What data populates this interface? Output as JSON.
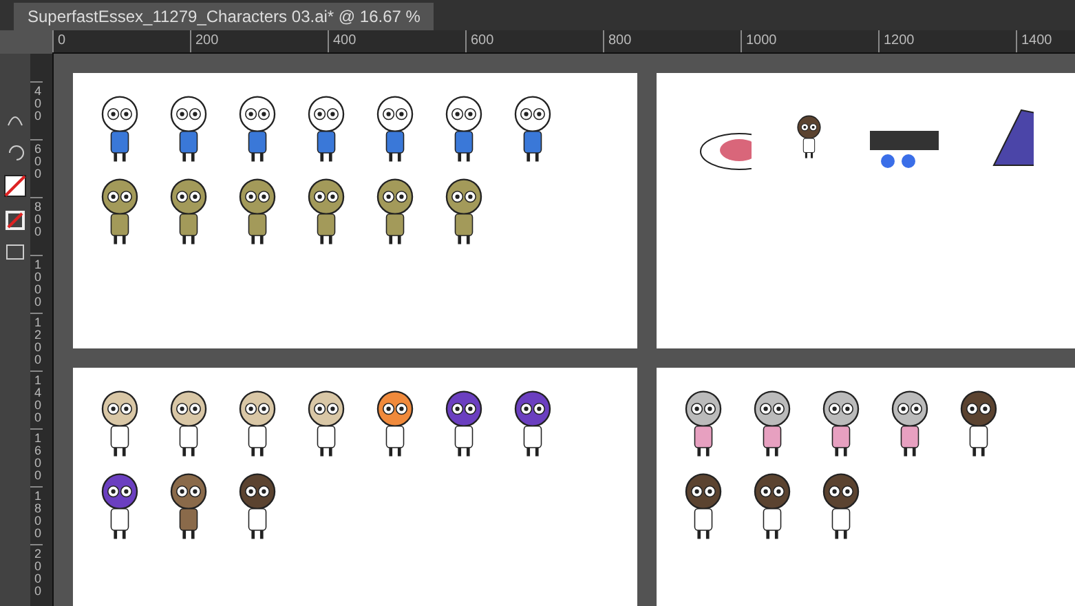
{
  "document_tab": {
    "title": "SuperfastEssex_11279_Characters 03.ai* @ 16.67 %"
  },
  "horizontal_ruler": {
    "labels": [
      "0",
      "200",
      "400",
      "600",
      "800",
      "1000",
      "1200",
      "1400"
    ]
  },
  "vertical_ruler": {
    "labels": [
      "400",
      "600",
      "800",
      "1000",
      "1200",
      "1400",
      "1600",
      "1800",
      "2000"
    ]
  }
}
